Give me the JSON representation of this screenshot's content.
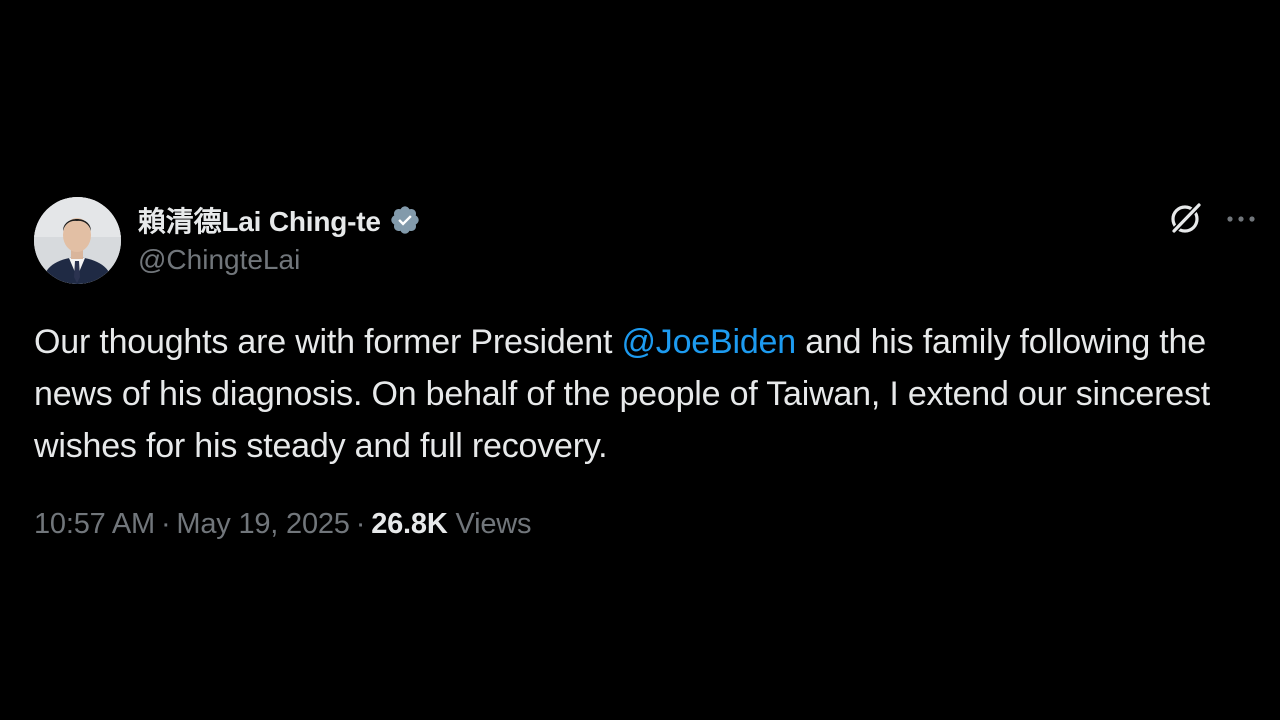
{
  "author": {
    "display_name": "賴清德Lai Ching-te",
    "handle": "@ChingteLai",
    "verified_icon": "verified-badge-icon",
    "avatar": "profile-photo"
  },
  "header_actions": {
    "grok_icon": "grok-icon",
    "more_icon": "more-horizontal-icon"
  },
  "tweet": {
    "text_before": "Our thoughts are with former President ",
    "mention": "@JoeBiden",
    "text_after": " and his family following the news of his diagnosis. On behalf of the people of Taiwan, I extend our sincerest wishes for his steady and full recovery."
  },
  "meta": {
    "time": "10:57 AM",
    "separator": "·",
    "date": "May 19, 2025",
    "views_count": "26.8K",
    "views_label": "Views"
  },
  "colors": {
    "background": "#000000",
    "text": "#e7e9ea",
    "secondary": "#71767b",
    "link": "#1d9bf0",
    "verified": "#829aab"
  }
}
